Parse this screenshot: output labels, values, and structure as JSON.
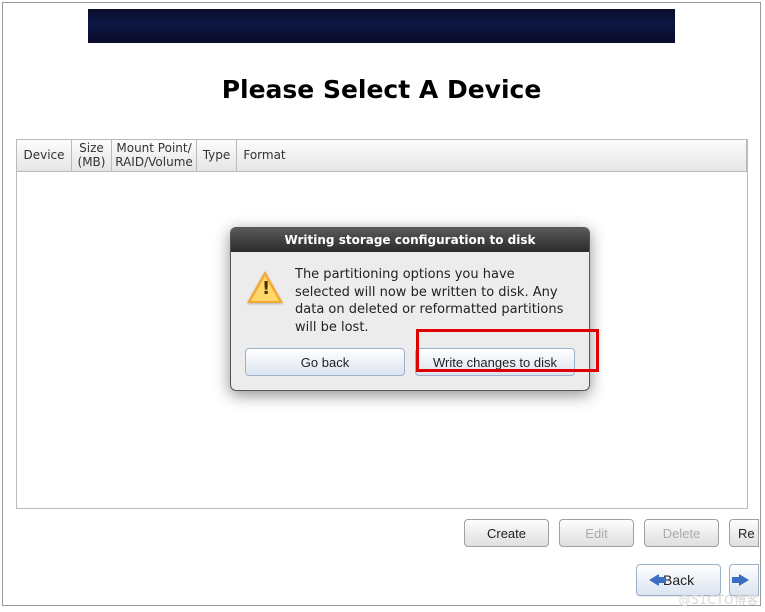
{
  "page": {
    "title": "Please Select A Device"
  },
  "table": {
    "headers": {
      "device": "Device",
      "size": "Size\n(MB)",
      "mount": "Mount Point/\nRAID/Volume",
      "type": "Type",
      "format": "Format"
    }
  },
  "actions": {
    "create": "Create",
    "edit": "Edit",
    "delete": "Delete",
    "reset": "Re"
  },
  "nav": {
    "back": "Back"
  },
  "dialog": {
    "title": "Writing storage configuration to disk",
    "message": "The partitioning options you have selected will now be written to disk.  Any data on deleted or reformatted partitions will be lost.",
    "go_back": "Go back",
    "write": "Write changes to disk"
  },
  "watermark": "@51CTO博客"
}
